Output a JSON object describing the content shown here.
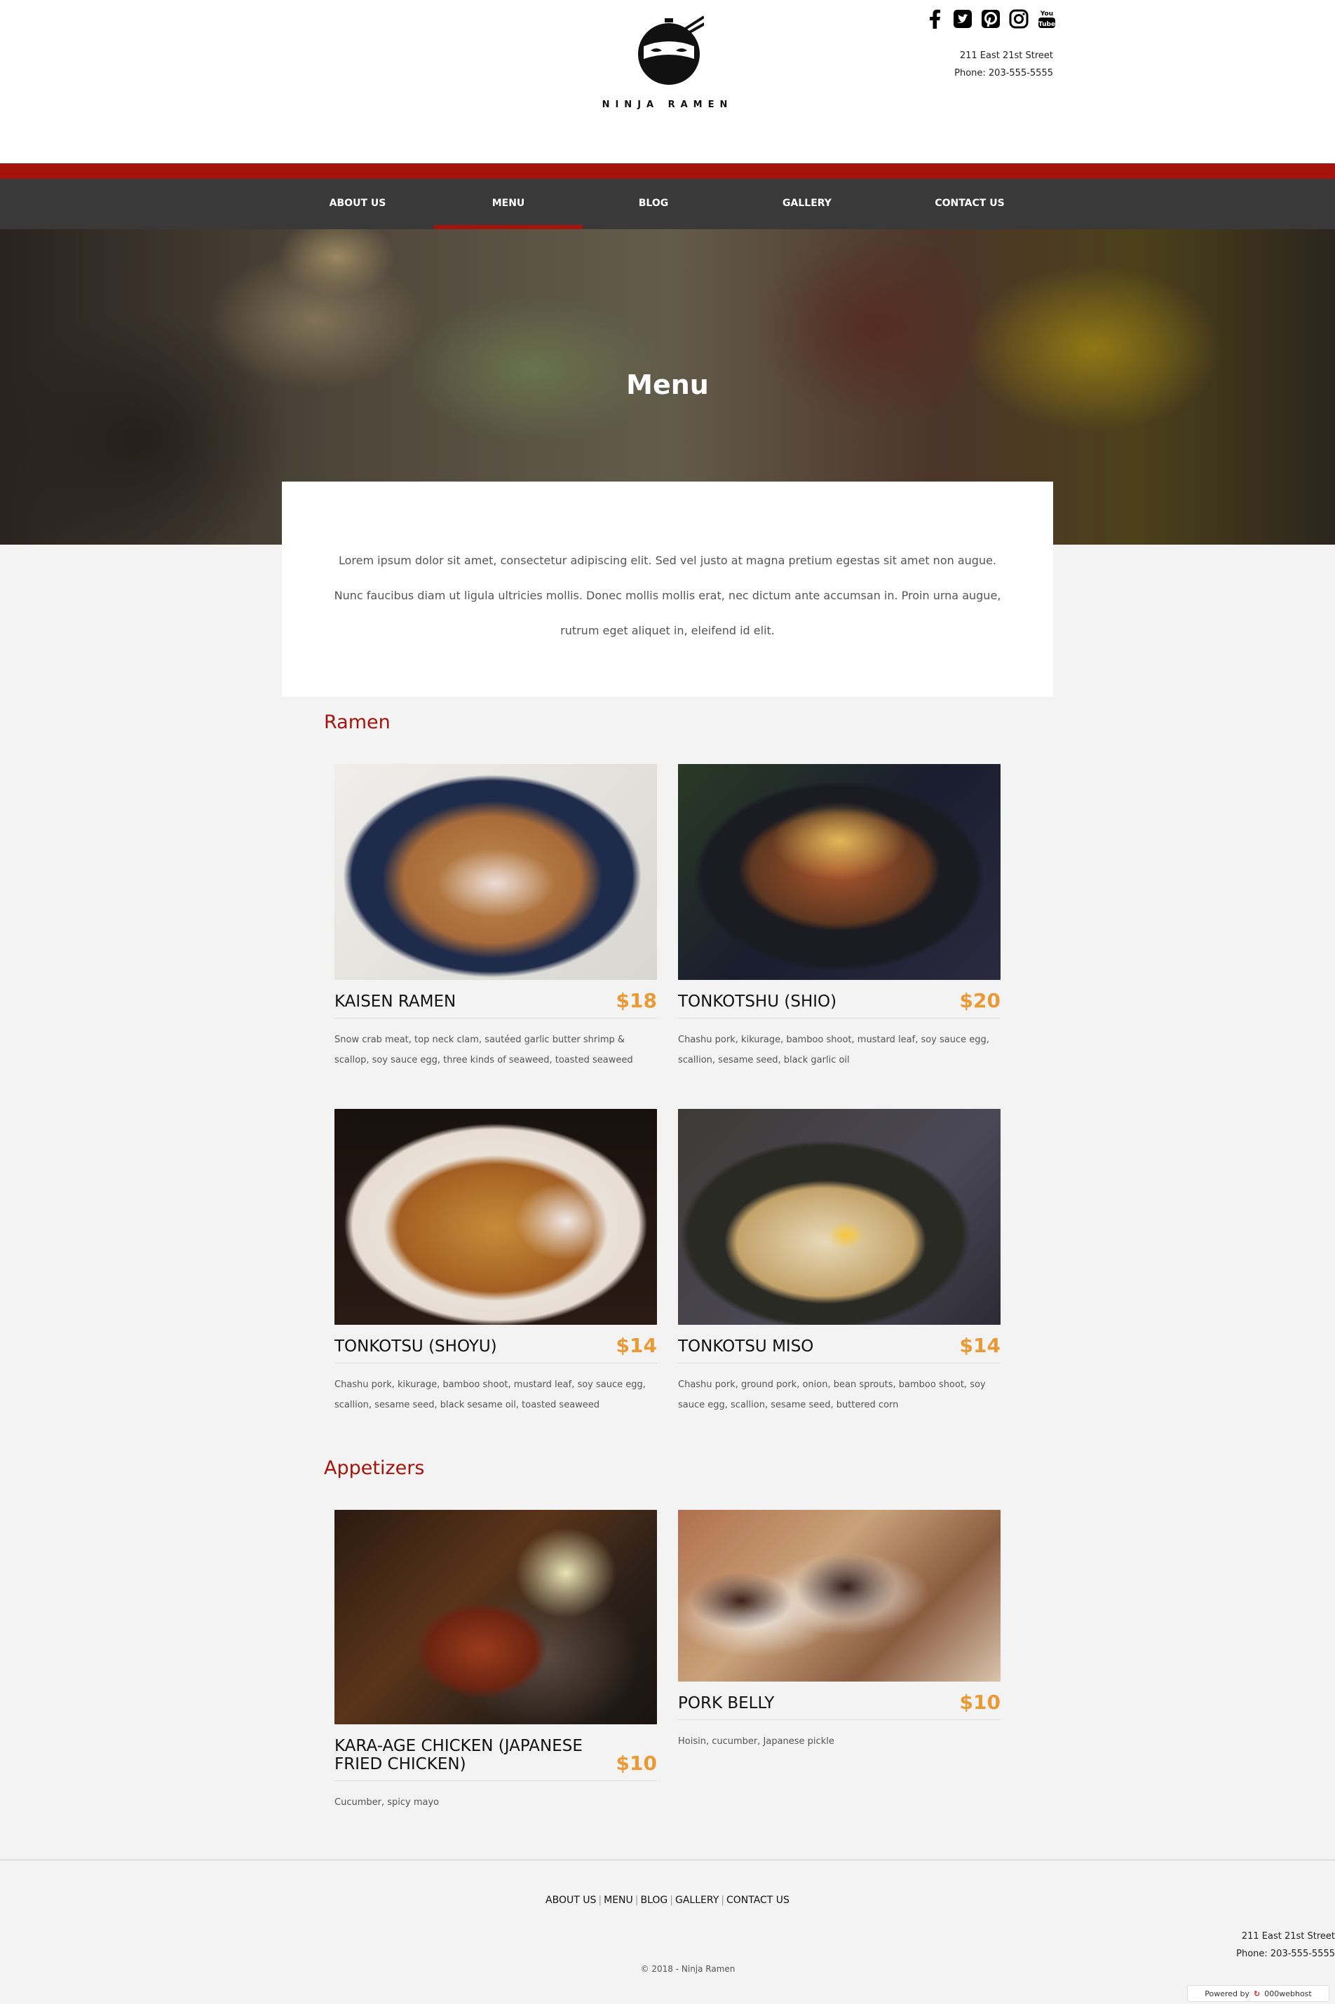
{
  "brand": {
    "name": "NINJA RAMEN"
  },
  "header": {
    "address_line": "211 East 21st Street",
    "phone_label": "Phone:",
    "phone_number": "203-555-5555",
    "socials": [
      "facebook-icon",
      "twitter-icon",
      "pinterest-icon",
      "instagram-icon",
      "youtube-icon"
    ],
    "youtube_text": "You Tube"
  },
  "nav": {
    "items": [
      {
        "label": "ABOUT US"
      },
      {
        "label": "MENU",
        "active": true
      },
      {
        "label": "BLOG"
      },
      {
        "label": "GALLERY"
      },
      {
        "label": "CONTACT US"
      }
    ]
  },
  "hero": {
    "title": "Menu"
  },
  "intro": {
    "lines": [
      "Lorem ipsum dolor sit amet, consectetur adipiscing elit. Sed vel justo at magna pretium egestas sit amet non augue.",
      "Nunc faucibus diam ut ligula ultricies mollis. Donec mollis mollis erat, nec dictum ante accumsan in. Proin urna augue,",
      "rutrum eget aliquet in, eleifend id elit."
    ]
  },
  "sections": [
    {
      "title": "Ramen",
      "items": [
        {
          "name": "KAISEN RAMEN",
          "price": "$18",
          "desc": "Snow crab meat, top neck clam, sautéed garlic butter shrimp & scallop, soy sauce egg, three kinds of seaweed, toasted seaweed"
        },
        {
          "name": "TONKOTSHU (SHIO)",
          "price": "$20",
          "desc": "Chashu pork, kikurage, bamboo shoot, mustard leaf, soy sauce egg, scallion, sesame seed, black garlic oil"
        },
        {
          "name": "TONKOTSU (SHOYU)",
          "price": "$14",
          "desc": "Chashu pork, kikurage, bamboo shoot, mustard leaf, soy sauce egg, scallion, sesame seed, black sesame oil, toasted seaweed"
        },
        {
          "name": "TONKOTSU MISO",
          "price": "$14",
          "desc": "Chashu pork, ground pork, onion, bean sprouts, bamboo shoot, soy sauce egg, scallion, sesame seed, buttered corn"
        }
      ]
    },
    {
      "title": "Appetizers",
      "items": [
        {
          "name": "KARA-AGE CHICKEN (JAPANESE FRIED CHICKEN)",
          "price": "$10",
          "desc": "Cucumber, spicy mayo"
        },
        {
          "name": "PORK BELLY",
          "price": "$10",
          "desc": "Hoisin, cucumber, Japanese pickle"
        }
      ]
    }
  ],
  "footer": {
    "links": [
      "ABOUT US",
      "MENU",
      "BLOG",
      "GALLERY",
      "CONTACT US"
    ],
    "separator": "|",
    "address_line": "211 East 21st Street",
    "phone_line": "Phone: 203-555-5555",
    "copyright": "© 2018 - Ninja Ramen",
    "powered_by": "Powered by",
    "host_name": "000webhost"
  },
  "colors": {
    "accent_red": "#a4130c",
    "price_orange": "#e99a34",
    "nav_bg": "#393939"
  }
}
